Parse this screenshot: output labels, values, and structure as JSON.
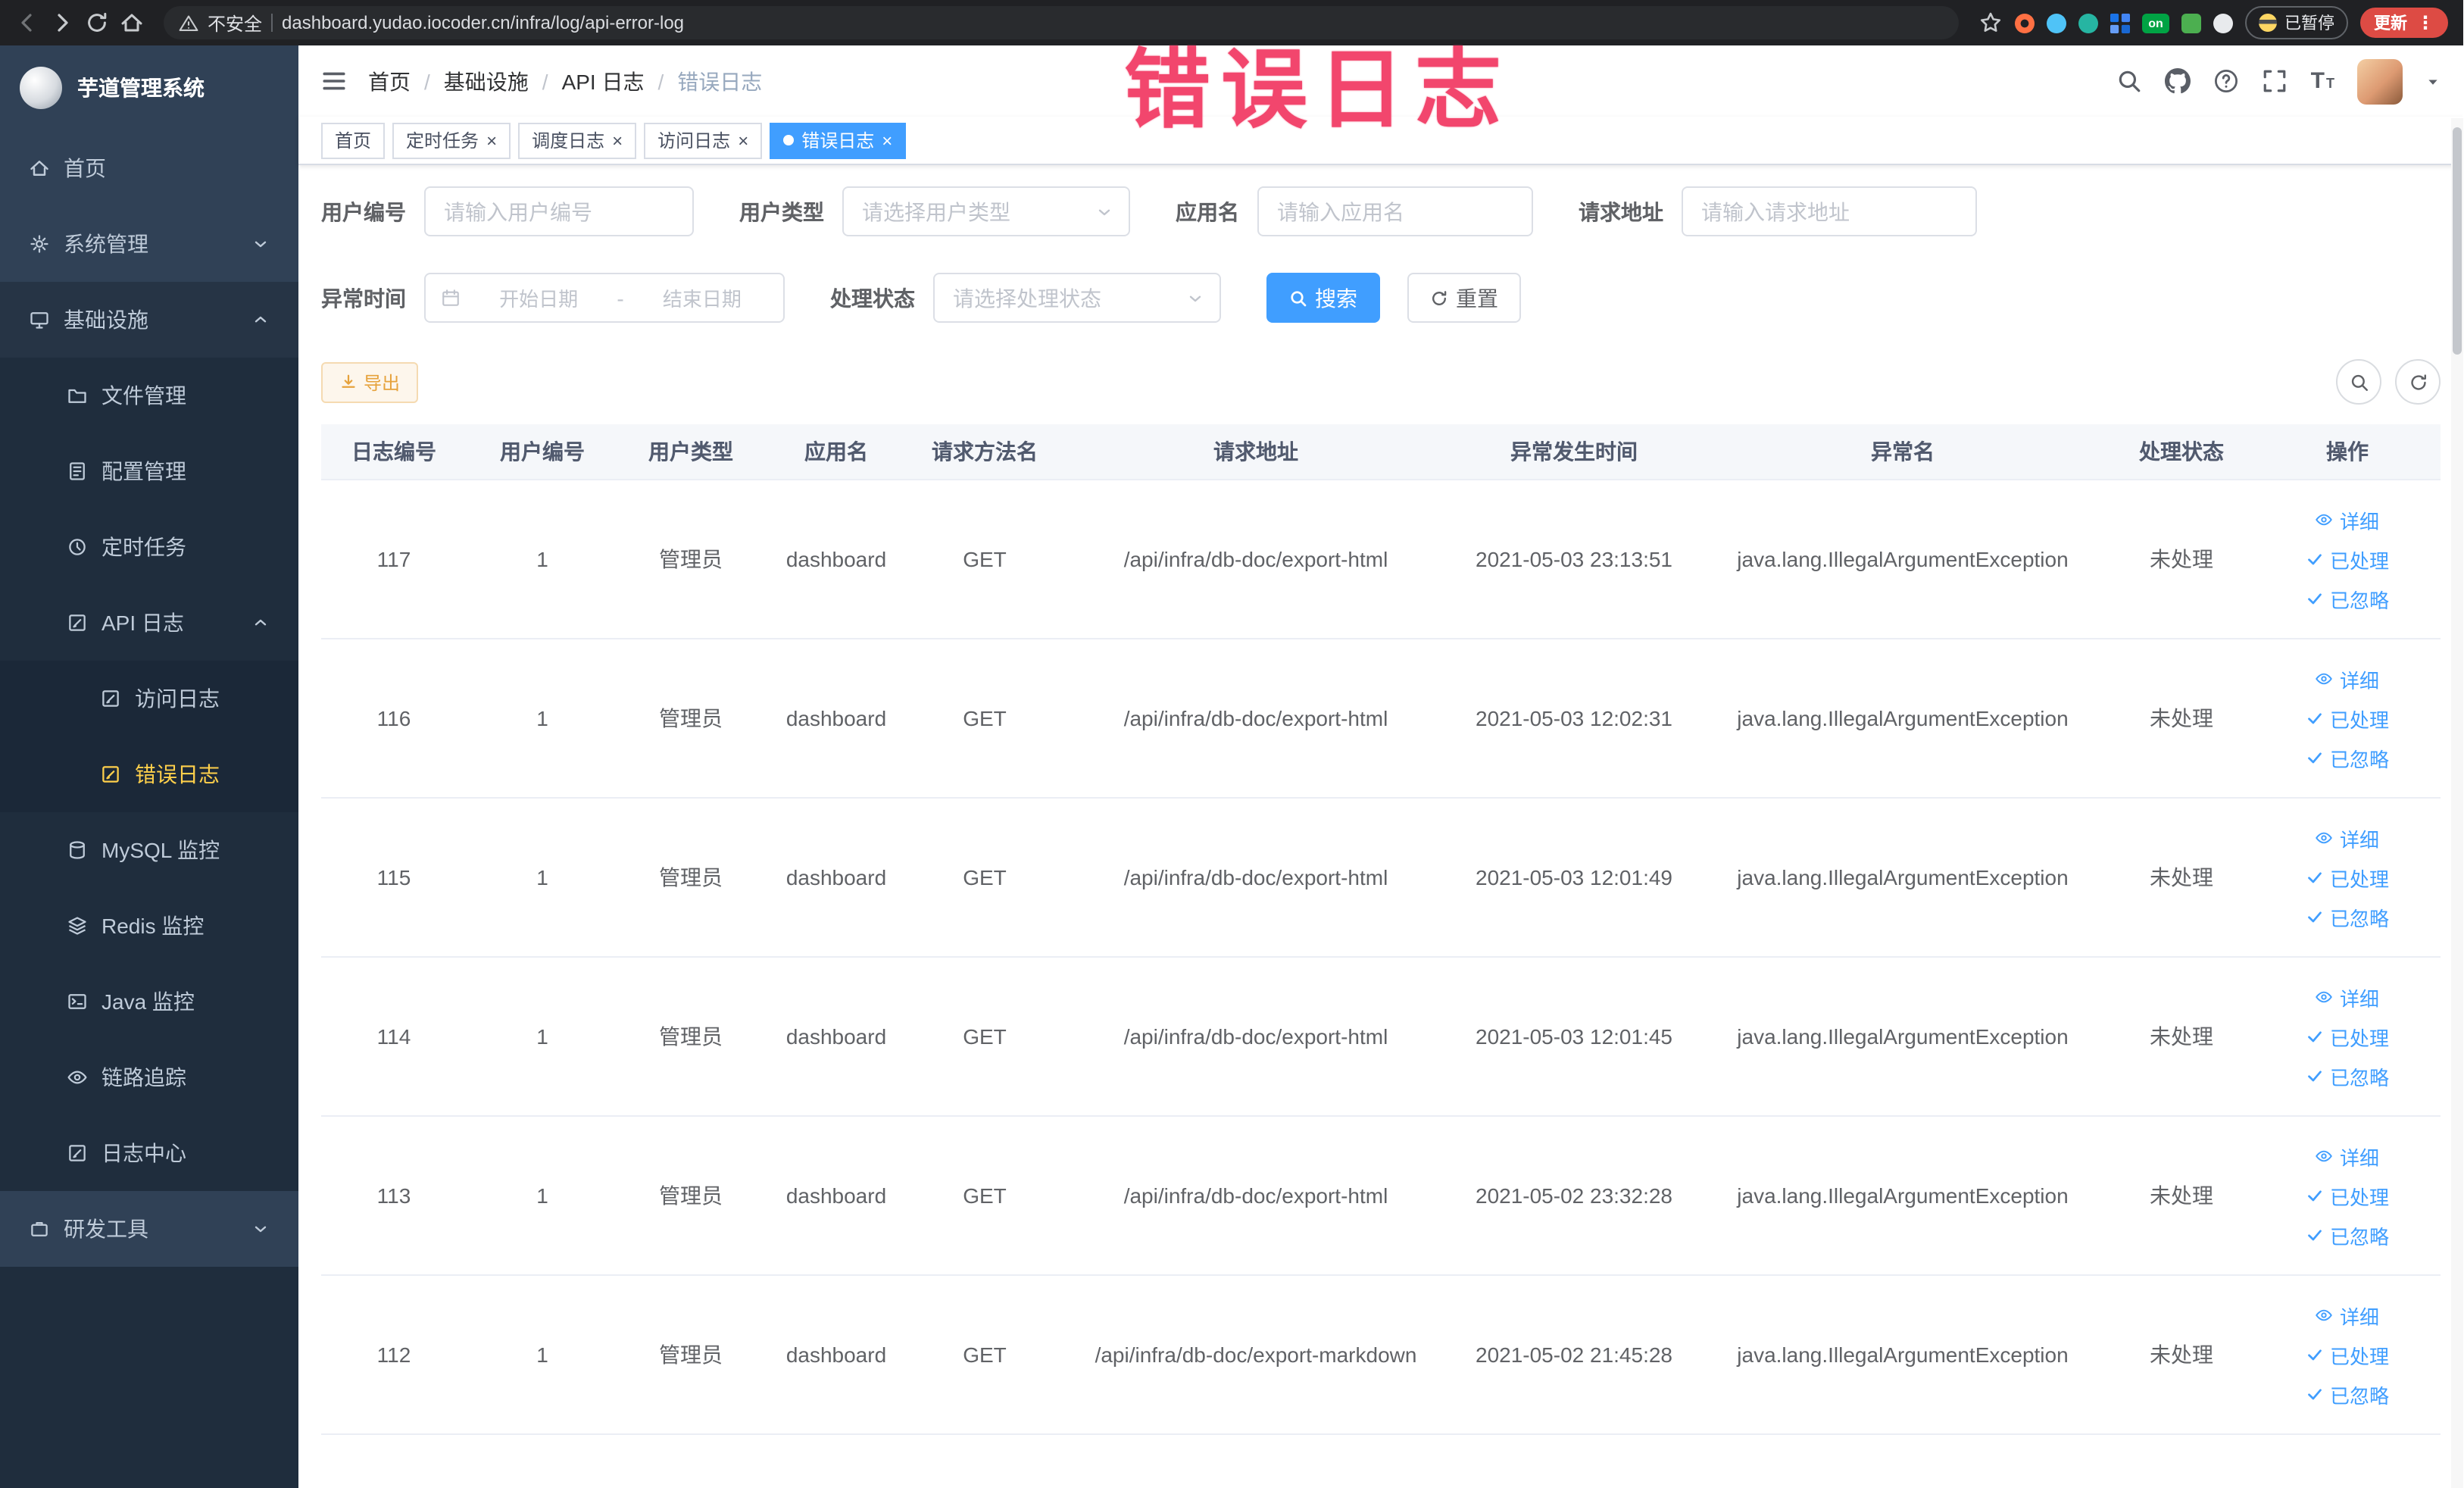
{
  "browser": {
    "security_label": "不安全",
    "url": "dashboard.yudao.iocoder.cn/infra/log/api-error-log",
    "extension_on_label": "on",
    "paused_label": "已暂停",
    "update_label": "更新"
  },
  "annotation": "错误日志",
  "sidebar": {
    "title": "芋道管理系统",
    "items": [
      {
        "label": "首页"
      },
      {
        "label": "系统管理"
      },
      {
        "label": "基础设施"
      },
      {
        "label": "文件管理"
      },
      {
        "label": "配置管理"
      },
      {
        "label": "定时任务"
      },
      {
        "label": "API 日志"
      },
      {
        "label": "访问日志"
      },
      {
        "label": "错误日志"
      },
      {
        "label": "MySQL 监控"
      },
      {
        "label": "Redis 监控"
      },
      {
        "label": "Java 监控"
      },
      {
        "label": "链路追踪"
      },
      {
        "label": "日志中心"
      },
      {
        "label": "研发工具"
      }
    ]
  },
  "breadcrumb": {
    "items": [
      {
        "label": "首页"
      },
      {
        "label": "基础设施"
      },
      {
        "label": "API 日志"
      },
      {
        "label": "错误日志"
      }
    ]
  },
  "tabs": [
    {
      "label": "首页"
    },
    {
      "label": "定时任务"
    },
    {
      "label": "调度日志"
    },
    {
      "label": "访问日志"
    },
    {
      "label": "错误日志"
    }
  ],
  "filters": {
    "user_id_label": "用户编号",
    "user_id_placeholder": "请输入用户编号",
    "user_type_label": "用户类型",
    "user_type_placeholder": "请选择用户类型",
    "app_name_label": "应用名",
    "app_name_placeholder": "请输入应用名",
    "request_url_label": "请求地址",
    "request_url_placeholder": "请输入请求地址",
    "exception_time_label": "异常时间",
    "start_placeholder": "开始日期",
    "range_separator": "-",
    "end_placeholder": "结束日期",
    "status_label": "处理状态",
    "status_placeholder": "请选择处理状态",
    "search_label": "搜索",
    "reset_label": "重置"
  },
  "toolbar": {
    "export_label": "导出"
  },
  "table": {
    "columns": [
      "日志编号",
      "用户编号",
      "用户类型",
      "应用名",
      "请求方法名",
      "请求地址",
      "异常发生时间",
      "异常名",
      "处理状态",
      "操作"
    ],
    "action_labels": {
      "detail": "详细",
      "processed": "已处理",
      "ignored": "已忽略"
    },
    "rows": [
      {
        "id": "117",
        "user_id": "1",
        "user_type": "管理员",
        "app": "dashboard",
        "method": "GET",
        "url": "/api/infra/db-doc/export-html",
        "time": "2021-05-03 23:13:51",
        "exception": "java.lang.IllegalArgumentException",
        "status": "未处理"
      },
      {
        "id": "116",
        "user_id": "1",
        "user_type": "管理员",
        "app": "dashboard",
        "method": "GET",
        "url": "/api/infra/db-doc/export-html",
        "time": "2021-05-03 12:02:31",
        "exception": "java.lang.IllegalArgumentException",
        "status": "未处理"
      },
      {
        "id": "115",
        "user_id": "1",
        "user_type": "管理员",
        "app": "dashboard",
        "method": "GET",
        "url": "/api/infra/db-doc/export-html",
        "time": "2021-05-03 12:01:49",
        "exception": "java.lang.IllegalArgumentException",
        "status": "未处理"
      },
      {
        "id": "114",
        "user_id": "1",
        "user_type": "管理员",
        "app": "dashboard",
        "method": "GET",
        "url": "/api/infra/db-doc/export-html",
        "time": "2021-05-03 12:01:45",
        "exception": "java.lang.IllegalArgumentException",
        "status": "未处理"
      },
      {
        "id": "113",
        "user_id": "1",
        "user_type": "管理员",
        "app": "dashboard",
        "method": "GET",
        "url": "/api/infra/db-doc/export-html",
        "time": "2021-05-02 23:32:28",
        "exception": "java.lang.IllegalArgumentException",
        "status": "未处理"
      },
      {
        "id": "112",
        "user_id": "1",
        "user_type": "管理员",
        "app": "dashboard",
        "method": "GET",
        "url": "/api/infra/db-doc/export-markdown",
        "time": "2021-05-02 21:45:28",
        "exception": "java.lang.IllegalArgumentException",
        "status": "未处理"
      }
    ]
  },
  "colors": {
    "accent": "#409eff",
    "sidebar_bg": "#304156",
    "submenu_bg": "#1f2d3d",
    "active_menu_text": "#ffd04b",
    "warning_button_text": "#e6a23c",
    "annotation": "#f2466d"
  }
}
